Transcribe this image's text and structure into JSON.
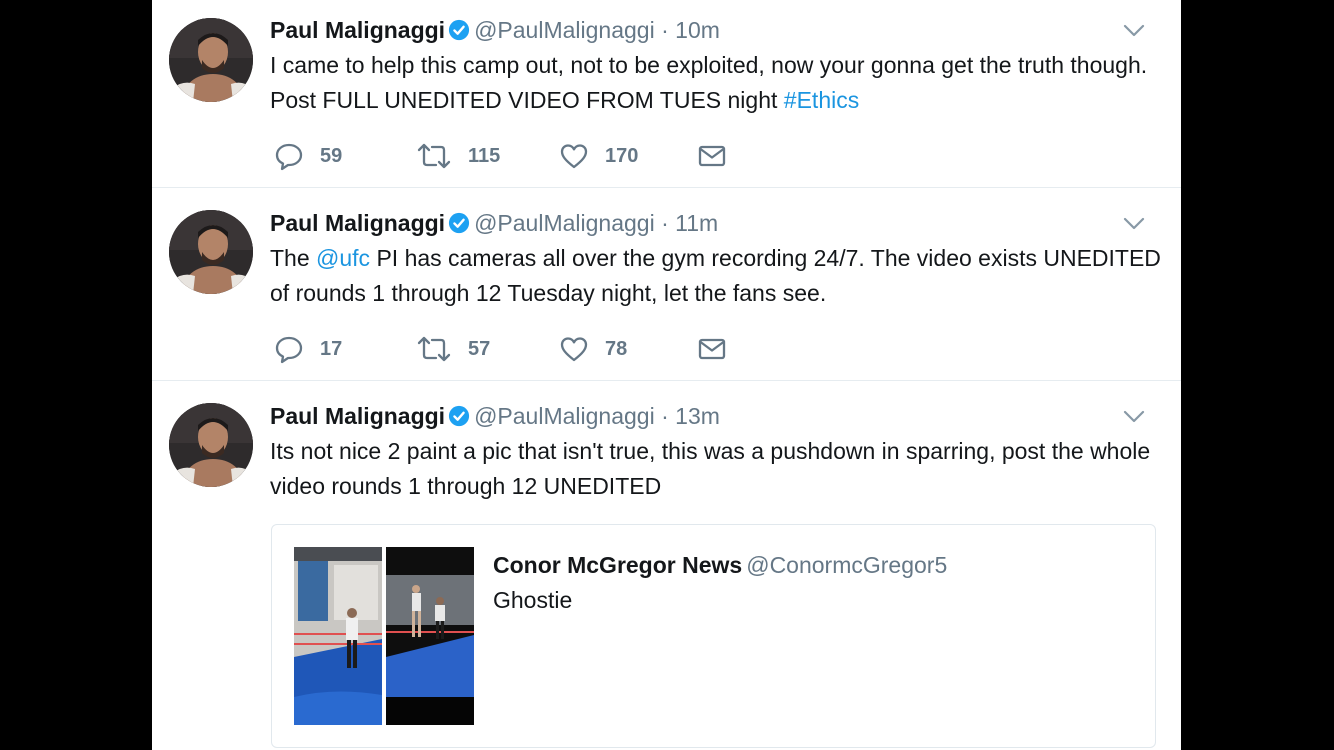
{
  "tweets": [
    {
      "author_name": "Paul Malignaggi",
      "author_handle": "@PaulMalignaggi",
      "separator": "·",
      "time": "10m",
      "text_before": "I came to help this camp out, not to be exploited, now your gonna get the truth though.  Post FULL UNEDITED VIDEO FROM TUES night ",
      "hashtag": "#Ethics",
      "replies": "59",
      "retweets": "115",
      "likes": "170"
    },
    {
      "author_name": "Paul Malignaggi",
      "author_handle": "@PaulMalignaggi",
      "separator": "·",
      "time": "11m",
      "text_before": "The ",
      "mention": "@ufc",
      "text_after": " PI has cameras all over the gym recording 24/7.  The video exists UNEDITED of rounds 1 through 12 Tuesday night, let the fans see.",
      "replies": "17",
      "retweets": "57",
      "likes": "78"
    },
    {
      "author_name": "Paul Malignaggi",
      "author_handle": "@PaulMalignaggi",
      "separator": "·",
      "time": "13m",
      "text": "Its not nice 2 paint a pic that isn't true, this was a pushdown in sparring, post the whole video rounds 1 through 12 UNEDITED",
      "quote": {
        "author_name": "Conor McGregor News",
        "author_handle": "@ConormcGregor5",
        "text": "Ghostie"
      }
    }
  ],
  "colors": {
    "link": "#1b95e0",
    "verified": "#1da1f2",
    "secondary_text": "#657786",
    "primary_text": "#14171a",
    "divider": "#e6ecf0"
  },
  "icons": [
    "verified-badge-icon",
    "chevron-down-icon",
    "reply-icon",
    "retweet-icon",
    "like-icon",
    "direct-message-icon"
  ]
}
